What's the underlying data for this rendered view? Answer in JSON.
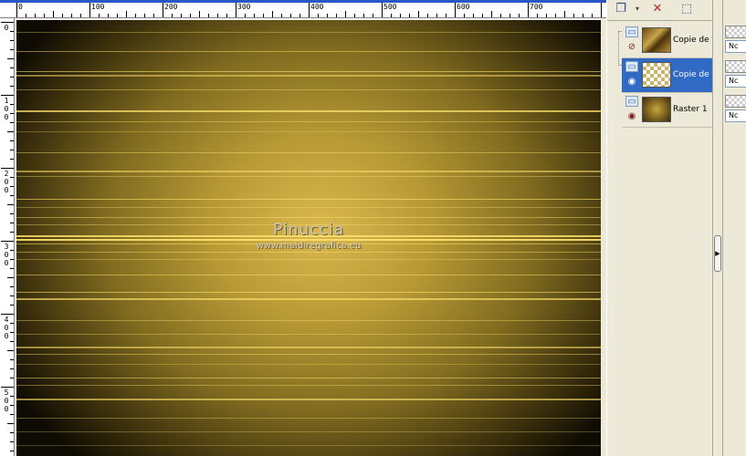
{
  "ruler": {
    "top_labels": [
      "0",
      "100",
      "200",
      "300",
      "400",
      "500",
      "600",
      "700"
    ],
    "left_labels": [
      [
        "0"
      ],
      [
        "1",
        "0",
        "0"
      ],
      [
        "2",
        "0",
        "0"
      ],
      [
        "3",
        "0",
        "0"
      ],
      [
        "4",
        "0",
        "0"
      ],
      [
        "5",
        "0",
        "0"
      ]
    ]
  },
  "canvas": {
    "watermark_title": "Pinuccia",
    "watermark_url": "www.maidiregrafica.eu"
  },
  "layers": {
    "items": [
      {
        "name": "Copie de R",
        "visible": false,
        "selected": false
      },
      {
        "name": "Copie de R",
        "visible": true,
        "selected": true
      },
      {
        "name": "Raster 1",
        "visible": true,
        "selected": false
      }
    ]
  },
  "properties": {
    "blend_values": [
      "Nc",
      "Nc",
      "Nc"
    ]
  },
  "colors": {
    "selection": "#316ac5",
    "panel_bg": "#ece9d8",
    "canvas_center": "#d9b84f",
    "canvas_edge": "#0e0b02"
  }
}
